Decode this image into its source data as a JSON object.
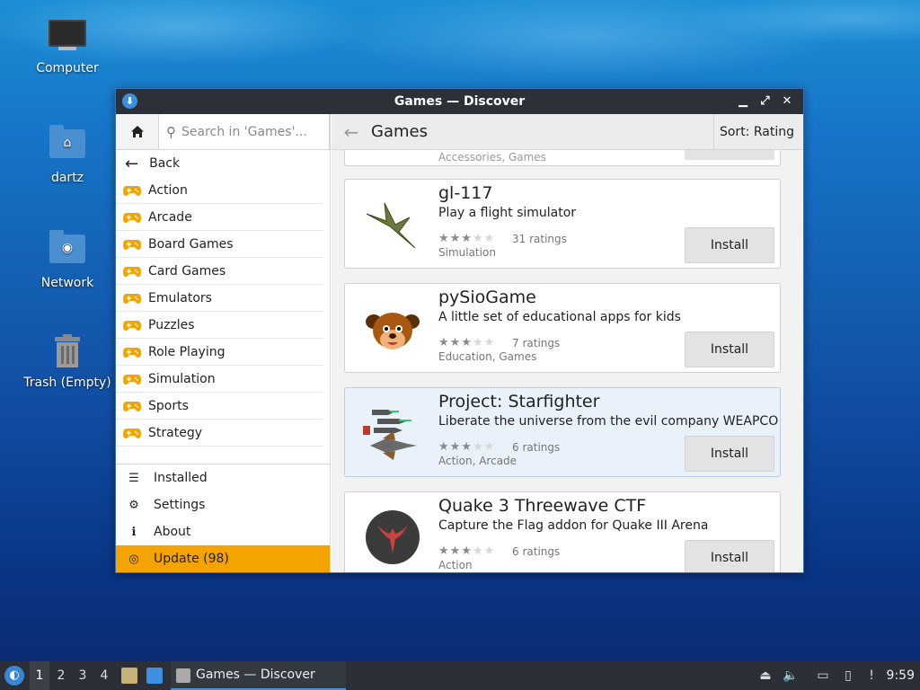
{
  "desktop": {
    "icons": [
      {
        "label": "Computer"
      },
      {
        "label": "dartz"
      },
      {
        "label": "Network"
      },
      {
        "label": "Trash (Empty)"
      }
    ]
  },
  "window": {
    "title": "Games — Discover"
  },
  "sidebar": {
    "search_placeholder": "Search in 'Games'...",
    "back_label": "Back",
    "categories": [
      {
        "label": "Action"
      },
      {
        "label": "Arcade"
      },
      {
        "label": "Board Games"
      },
      {
        "label": "Card Games"
      },
      {
        "label": "Emulators"
      },
      {
        "label": "Puzzles"
      },
      {
        "label": "Role Playing"
      },
      {
        "label": "Simulation"
      },
      {
        "label": "Sports"
      },
      {
        "label": "Strategy"
      }
    ],
    "nav": [
      {
        "label": "Installed",
        "icon": "list-icon"
      },
      {
        "label": "Settings",
        "icon": "gear-icon"
      },
      {
        "label": "About",
        "icon": "info-icon"
      },
      {
        "label": "Update (98)",
        "icon": "update-icon"
      }
    ]
  },
  "main": {
    "title": "Games",
    "sort_label": "Sort: Rating",
    "partial_card_category": "Accessories, Games",
    "apps": [
      {
        "name": "gl-117",
        "description": "Play a flight simulator",
        "stars": 3,
        "ratings": "31 ratings",
        "category": "Simulation",
        "install_label": "Install",
        "highlighted": false
      },
      {
        "name": "pySioGame",
        "description": "A little set of educational apps for kids",
        "stars": 3,
        "ratings": "7 ratings",
        "category": "Education, Games",
        "install_label": "Install",
        "highlighted": false
      },
      {
        "name": "Project: Starfighter",
        "description": "Liberate the universe from the evil company WEAPCO",
        "stars": 3,
        "ratings": "6 ratings",
        "category": "Action, Arcade",
        "install_label": "Install",
        "highlighted": true
      },
      {
        "name": "Quake 3 Threewave CTF",
        "description": "Capture the Flag addon for Quake III Arena",
        "stars": 3,
        "ratings": "6 ratings",
        "category": "Action",
        "install_label": "Install",
        "highlighted": false
      }
    ]
  },
  "taskbar": {
    "workspaces": [
      "1",
      "2",
      "3",
      "4"
    ],
    "active_workspace": "1",
    "task_label": "Games — Discover",
    "clock": "9:59"
  },
  "colors": {
    "accent": "#f5a300",
    "titlebar": "#2c3037",
    "taskbar": "#2c2f35",
    "highlight_card": "#e9f2fb"
  }
}
